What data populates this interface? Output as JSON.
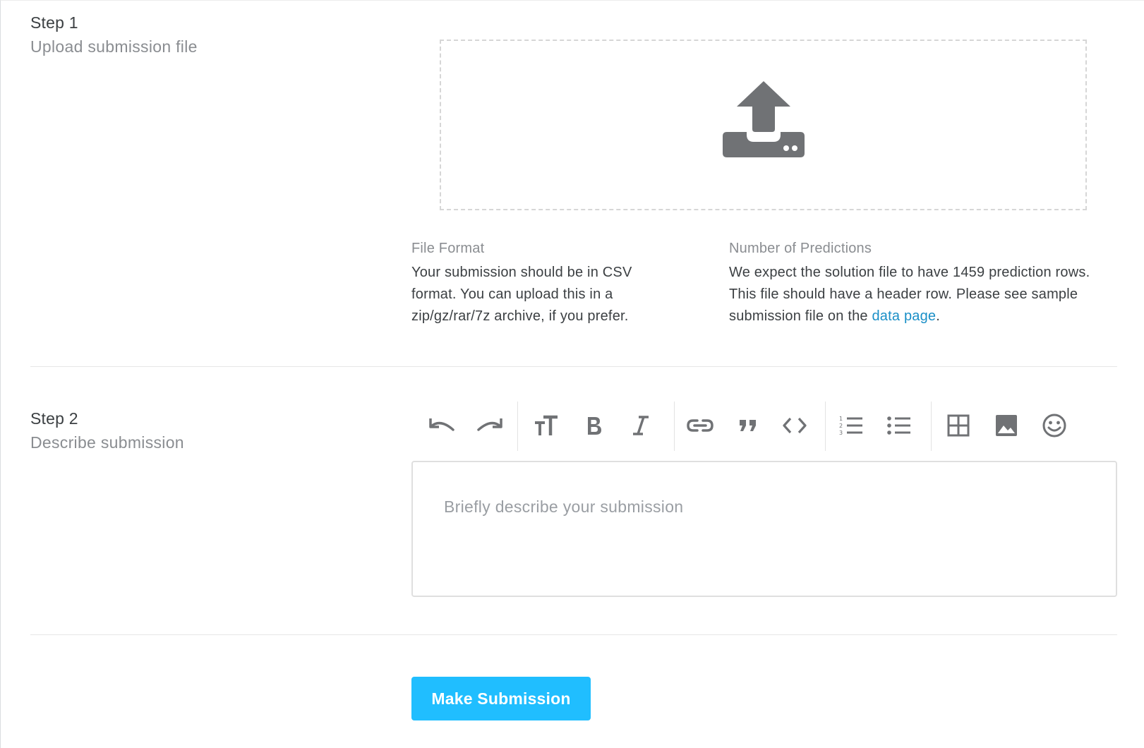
{
  "step1": {
    "title": "Step 1",
    "subtitle": "Upload submission file",
    "dropzone_icon": "upload-icon",
    "file_format": {
      "label": "File Format",
      "body": "Your submission should be in CSV format. You can upload this in a zip/gz/rar/7z archive, if you prefer."
    },
    "predictions": {
      "label": "Number of Predictions",
      "body_before_link": "We expect the solution file to have 1459 prediction rows. This file should have a header row. Please see sample submission file on the ",
      "link_text": "data page",
      "body_after_link": "."
    }
  },
  "step2": {
    "title": "Step 2",
    "subtitle": "Describe submission",
    "toolbar": [
      {
        "name": "undo",
        "icon": "undo-icon"
      },
      {
        "name": "redo",
        "icon": "redo-icon"
      },
      {
        "name": "heading",
        "icon": "text-size-icon"
      },
      {
        "name": "bold",
        "icon": "bold-icon"
      },
      {
        "name": "italic",
        "icon": "italic-icon"
      },
      {
        "name": "link",
        "icon": "link-icon"
      },
      {
        "name": "quote",
        "icon": "quote-icon"
      },
      {
        "name": "code",
        "icon": "code-icon"
      },
      {
        "name": "ordered-list",
        "icon": "ordered-list-icon"
      },
      {
        "name": "bullet-list",
        "icon": "bullet-list-icon"
      },
      {
        "name": "table",
        "icon": "table-icon"
      },
      {
        "name": "image",
        "icon": "image-icon"
      },
      {
        "name": "emoji",
        "icon": "emoji-icon"
      }
    ],
    "editor": {
      "value": "",
      "placeholder": "Briefly describe your submission"
    }
  },
  "submit": {
    "label": "Make Submission"
  },
  "colors": {
    "accent": "#20beff",
    "link": "#1a8fc7",
    "icon": "#707275"
  }
}
